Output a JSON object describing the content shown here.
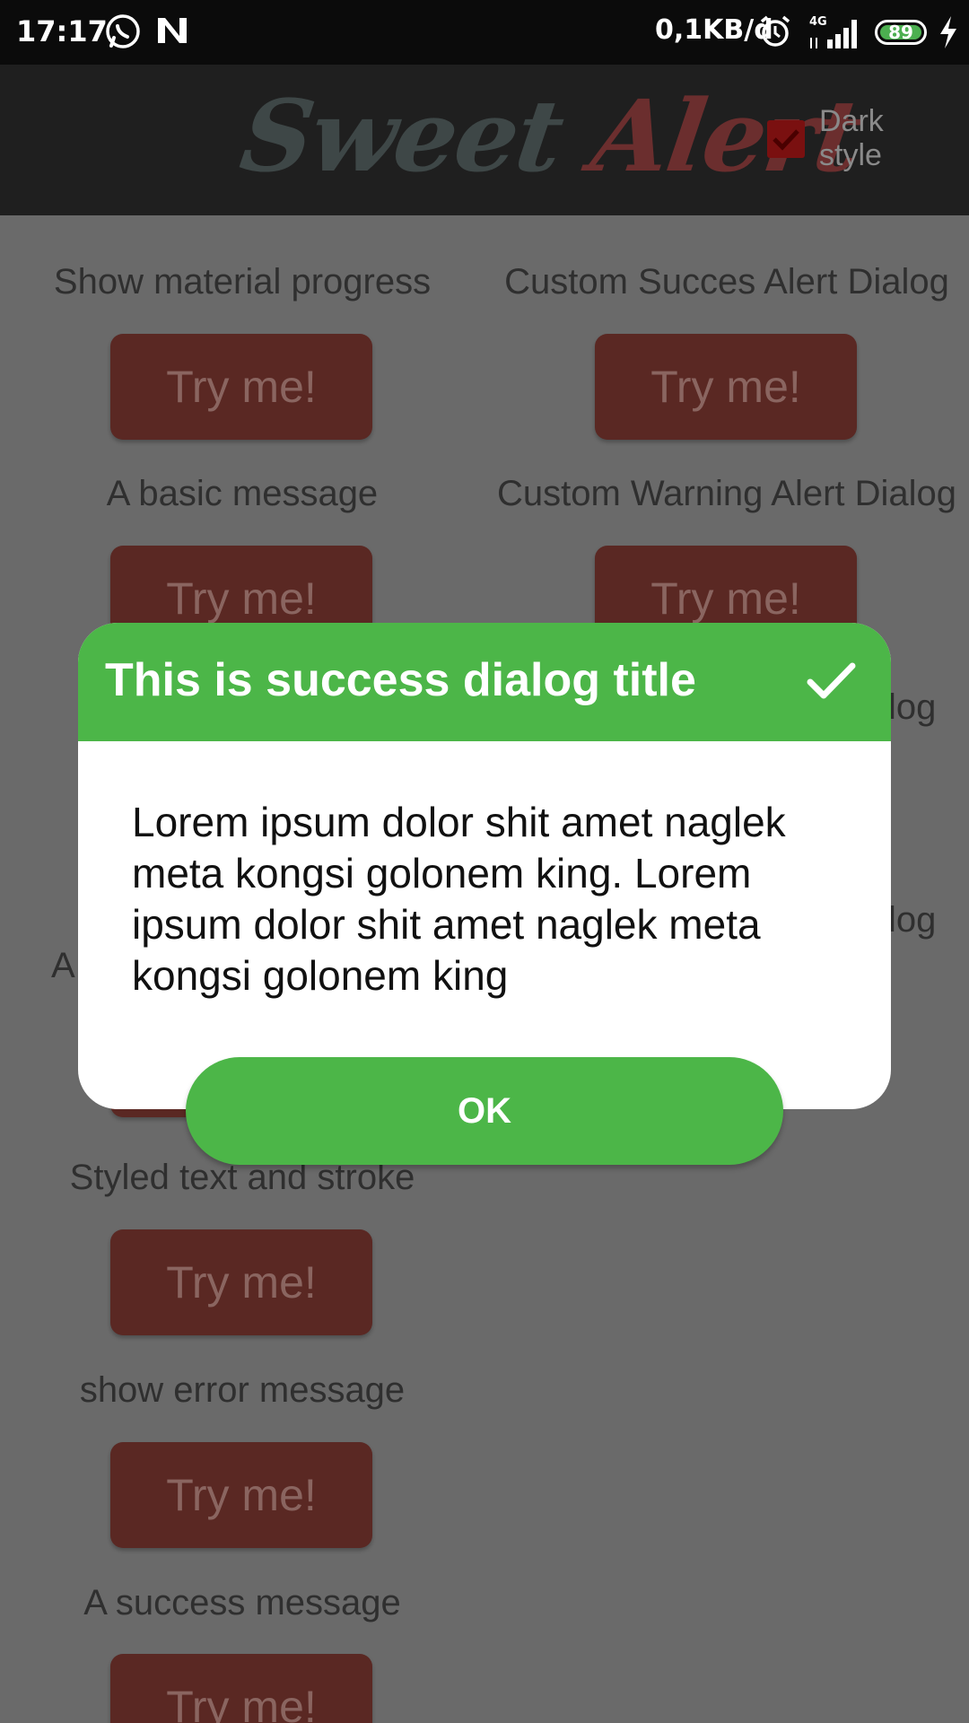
{
  "status_bar": {
    "time": "17:17",
    "network_speed": "0,1KB/d",
    "network_type": "4G",
    "battery": "89",
    "icons": [
      "whatsapp-icon",
      "n-notification-icon",
      "alarm-icon",
      "signal-icon",
      "battery-icon",
      "charging-icon"
    ]
  },
  "header": {
    "logo_word1": "Sweet",
    "logo_word2": "Alert",
    "dark_style_label": "Dark style",
    "dark_style_checked": true
  },
  "left_column": [
    {
      "label": "Show material progress",
      "button": "Try me!"
    },
    {
      "label": "A basic message",
      "button": "Try me!"
    },
    {
      "label": "A",
      "button": ""
    },
    {
      "label": "Styled text and stroke",
      "button": "Try me!"
    },
    {
      "label": "show error message",
      "button": "Try me!"
    },
    {
      "label": "A success message",
      "button": "Try me!"
    }
  ],
  "right_column": [
    {
      "label": "Custom Succes Alert Dialog",
      "button": "Try me!"
    },
    {
      "label": "Custom Warning Alert Dialog",
      "button": "Try me!"
    },
    {
      "label": "log",
      "button": ""
    },
    {
      "label": "log",
      "button": ""
    }
  ],
  "dialog": {
    "title": "This is success dialog title",
    "body": "Lorem ipsum dolor shit amet naglek meta kongsi golonem king. Lorem ipsum dolor shit amet naglek meta kongsi golonem king",
    "ok_label": "OK"
  },
  "colors": {
    "success_green": "#4cb648",
    "button_dimmed": "#5a2823",
    "overlay_bg": "#6a6a6a",
    "header_bg": "#1f1f1f"
  }
}
